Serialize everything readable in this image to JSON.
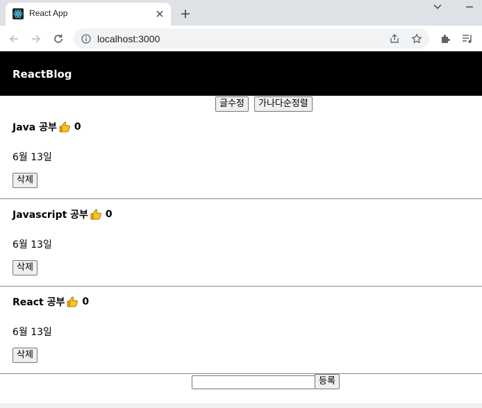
{
  "browser": {
    "tab_title": "React App",
    "url": "localhost:3000"
  },
  "header": {
    "brand": "ReactBlog"
  },
  "sort_buttons": {
    "edit_label": "글수정",
    "sort_label": "가나다순정렬"
  },
  "posts": [
    {
      "title": "Java 공부",
      "likes": "0",
      "date": "6월 13일",
      "delete_label": "삭제"
    },
    {
      "title": "Javascript 공부",
      "likes": "0",
      "date": "6월 13일",
      "delete_label": "삭제"
    },
    {
      "title": "React 공부",
      "likes": "0",
      "date": "6월 13일",
      "delete_label": "삭제"
    }
  ],
  "new_post": {
    "value": "",
    "submit_label": "등록"
  },
  "icons": {
    "like": "thumbs-up-icon",
    "favicon": "react-logo-icon"
  },
  "colors": {
    "navbar": "#000000",
    "brand_text": "#ffffff",
    "tabstrip": "#dee1e6",
    "omnibox": "#f1f3f4"
  }
}
